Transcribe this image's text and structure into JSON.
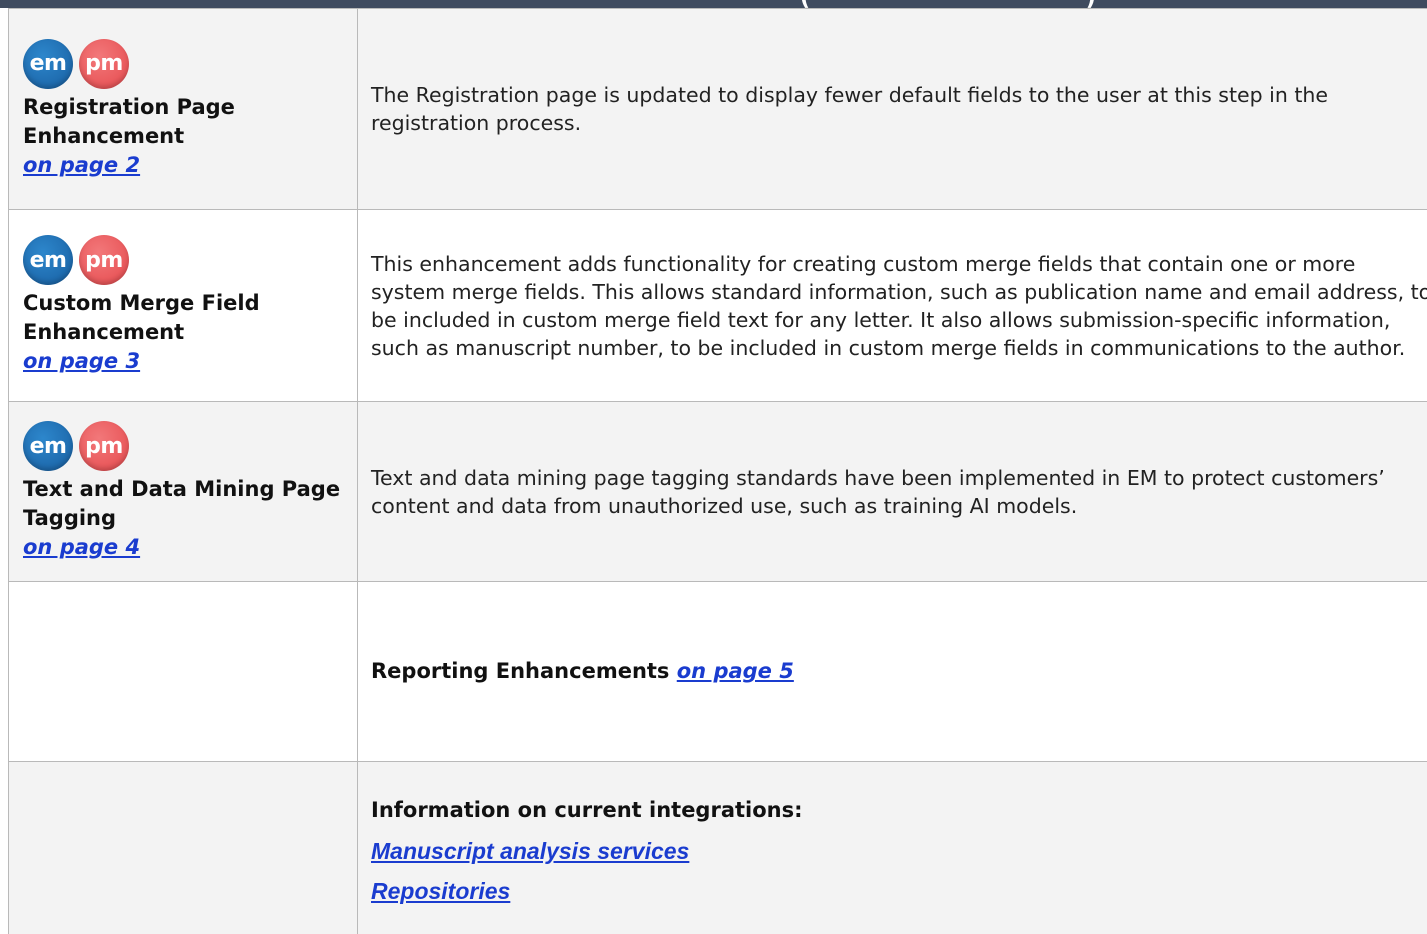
{
  "header": {
    "cut_text": "(                                    )"
  },
  "rows": [
    {
      "badges": [
        "em",
        "pm"
      ],
      "title": "Registration Page Enhancement",
      "link": "on page 2",
      "description": "The Registration page is updated to display fewer default fields to the user at this step in the registration process."
    },
    {
      "badges": [
        "em",
        "pm"
      ],
      "title": "Custom Merge Field Enhancement",
      "link": "on page 3",
      "description": "This enhancement adds functionality for creating custom merge fields that contain one or more system merge fields. This allows standard information, such as publication name and email address, to be included in custom merge field text for any letter. It also allows submission-specific information, such as manuscript number, to be included in custom merge fields in communications to the author."
    },
    {
      "badges": [
        "em",
        "pm"
      ],
      "title": "Text and Data Mining Page Tagging",
      "link": "on page 4",
      "description": "Text and data mining page tagging standards have been implemented in EM to protect customers’ content and data from unauthorized use, such as training AI models."
    }
  ],
  "reporting": {
    "label": "Reporting Enhancements",
    "link": "on page 5"
  },
  "integrations": {
    "heading": "Information on current integrations:",
    "links": [
      "Manuscript analysis services",
      "Repositories"
    ]
  },
  "colors": {
    "em_badge": "#1e6aad",
    "pm_badge": "#e9575a",
    "link": "#1a3ccf",
    "header_bar": "#3f4b5f"
  }
}
